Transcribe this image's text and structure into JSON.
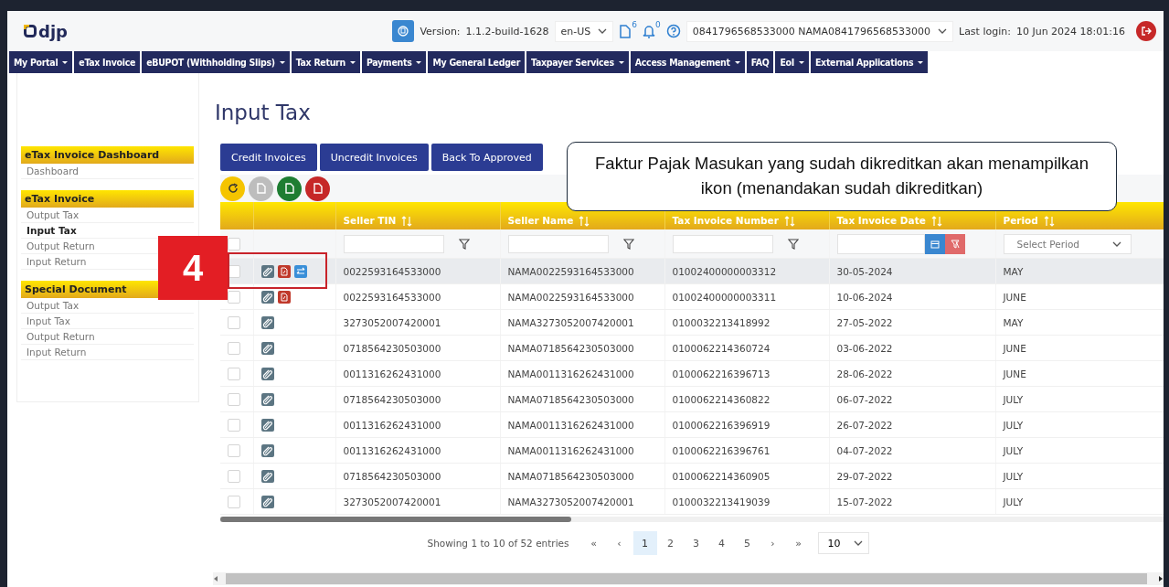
{
  "header": {
    "logo": "djp",
    "version_label": "Version:",
    "version": "1.1.2-build-1628",
    "language": "en-US",
    "document_count": "6",
    "notification_count": "0",
    "account": "0841796568533000 NAMA0841796568533000",
    "last_login_label": "Last login:",
    "last_login": "10 Jun 2024 18:01:16"
  },
  "nav": [
    {
      "label": "My Portal",
      "dropdown": true
    },
    {
      "label": "eTax Invoice",
      "dropdown": false
    },
    {
      "label": "eBUPOT (Withholding Slips)",
      "dropdown": true
    },
    {
      "label": "Tax Return",
      "dropdown": true
    },
    {
      "label": "Payments",
      "dropdown": true
    },
    {
      "label": "My General Ledger",
      "dropdown": false
    },
    {
      "label": "Taxpayer Services",
      "dropdown": true
    },
    {
      "label": "Access Management",
      "dropdown": true
    },
    {
      "label": "FAQ",
      "dropdown": false
    },
    {
      "label": "EoI",
      "dropdown": true
    },
    {
      "label": "External Applications",
      "dropdown": true
    }
  ],
  "sidebar": [
    {
      "title": "eTax Invoice Dashboard",
      "items": [
        {
          "label": "Dashboard",
          "selected": false
        }
      ]
    },
    {
      "title": "eTax Invoice",
      "items": [
        {
          "label": "Output Tax",
          "selected": false
        },
        {
          "label": "Input Tax",
          "selected": true
        },
        {
          "label": "Output Return",
          "selected": false
        },
        {
          "label": "Input Return",
          "selected": false
        }
      ]
    },
    {
      "title": "Special Document",
      "items": [
        {
          "label": "Output Tax",
          "selected": false
        },
        {
          "label": "Input Tax",
          "selected": false
        },
        {
          "label": "Output Return",
          "selected": false
        },
        {
          "label": "Input Return",
          "selected": false
        }
      ]
    }
  ],
  "page_title": "Input Tax",
  "buttons": [
    "Credit Invoices",
    "Uncredit Invoices",
    "Back To Approved"
  ],
  "toolbar": [
    {
      "kind": "refresh"
    },
    {
      "kind": "file",
      "color": "#bdbdbd"
    },
    {
      "kind": "file",
      "color": "#1e7d32"
    },
    {
      "kind": "file",
      "color": "#c62828"
    }
  ],
  "table": {
    "columns": [
      "Seller TIN",
      "Seller Name",
      "Tax Invoice Number",
      "Tax Invoice Date",
      "Period"
    ],
    "period_placeholder": "Select Period",
    "select_all_checked": false,
    "rows": [
      {
        "selected": true,
        "checked": false,
        "pdf": true,
        "credited": true,
        "cells": [
          "0022593164533000",
          "NAMA0022593164533000",
          "01002400000003312",
          "30-05-2024",
          "MAY"
        ]
      },
      {
        "selected": false,
        "checked": false,
        "pdf": true,
        "credited": false,
        "cells": [
          "0022593164533000",
          "NAMA0022593164533000",
          "01002400000003311",
          "10-06-2024",
          "JUNE"
        ]
      },
      {
        "selected": false,
        "checked": false,
        "pdf": false,
        "credited": false,
        "cells": [
          "3273052007420001",
          "NAMA3273052007420001",
          "0100032213418992",
          "27-05-2022",
          "MAY"
        ]
      },
      {
        "selected": false,
        "checked": false,
        "pdf": false,
        "credited": false,
        "cells": [
          "0718564230503000",
          "NAMA0718564230503000",
          "0100062214360724",
          "03-06-2022",
          "JUNE"
        ]
      },
      {
        "selected": false,
        "checked": false,
        "pdf": false,
        "credited": false,
        "cells": [
          "0011316262431000",
          "NAMA0011316262431000",
          "0100062216396713",
          "28-06-2022",
          "JUNE"
        ]
      },
      {
        "selected": false,
        "checked": false,
        "pdf": false,
        "credited": false,
        "cells": [
          "0718564230503000",
          "NAMA0718564230503000",
          "0100062214360822",
          "06-07-2022",
          "JULY"
        ]
      },
      {
        "selected": false,
        "checked": false,
        "pdf": false,
        "credited": false,
        "cells": [
          "0011316262431000",
          "NAMA0011316262431000",
          "0100062216396919",
          "26-07-2022",
          "JULY"
        ]
      },
      {
        "selected": false,
        "checked": false,
        "pdf": false,
        "credited": false,
        "cells": [
          "0011316262431000",
          "NAMA0011316262431000",
          "0100062216396761",
          "04-07-2022",
          "JULY"
        ]
      },
      {
        "selected": false,
        "checked": false,
        "pdf": false,
        "credited": false,
        "cells": [
          "0718564230503000",
          "NAMA0718564230503000",
          "0100062214360905",
          "29-07-2022",
          "JULY"
        ]
      },
      {
        "selected": false,
        "checked": false,
        "pdf": false,
        "credited": false,
        "cells": [
          "3273052007420001",
          "NAMA3273052007420001",
          "0100032213419039",
          "15-07-2022",
          "JULY"
        ]
      }
    ]
  },
  "pagination": {
    "summary": "Showing 1 to 10 of 52 entries",
    "first": "«",
    "prev": "‹",
    "pages": [
      {
        "label": "1",
        "selected": true
      },
      {
        "label": "2",
        "selected": false
      },
      {
        "label": "3",
        "selected": false
      },
      {
        "label": "4",
        "selected": false
      },
      {
        "label": "5",
        "selected": false
      }
    ],
    "next": "›",
    "last": "»",
    "page_size": "10"
  },
  "annotation": {
    "step": "4",
    "callout": "Faktur Pajak Masukan yang sudah dikreditkan akan menampilkan ikon (menandakan sudah dikreditkan)"
  }
}
